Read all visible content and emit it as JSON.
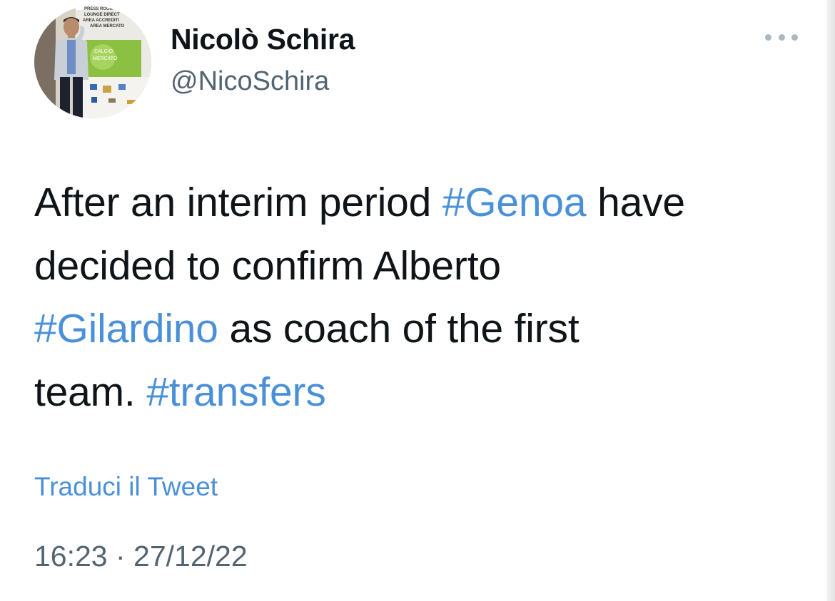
{
  "author": {
    "name": "Nicolò Schira",
    "handle": "@NicoSchira"
  },
  "avatar_sign_lines": [
    "PRESS ROOM",
    "LOUNGE DIRECT",
    "AREA ACCREDITI",
    "AREA MERCATO"
  ],
  "avatar_banner_text": [
    "CALCIO",
    "MERCATO"
  ],
  "tweet": {
    "lines": [
      [
        {
          "text": "After an interim period ",
          "hashtag": false
        },
        {
          "text": "#Genoa",
          "hashtag": true
        },
        {
          "text": " have",
          "hashtag": false
        }
      ],
      [
        {
          "text": "decided to confirm Alberto",
          "hashtag": false
        }
      ],
      [
        {
          "text": "#Gilardino",
          "hashtag": true
        },
        {
          "text": " as coach of the first",
          "hashtag": false
        }
      ],
      [
        {
          "text": "team. ",
          "hashtag": false
        },
        {
          "text": "#transfers",
          "hashtag": true
        }
      ]
    ]
  },
  "translate_label": "Traduci il Tweet",
  "timestamp": "16:23 · 27/12/22",
  "colors": {
    "text": "#0f1419",
    "secondary": "#536471",
    "link": "#4a90d9"
  },
  "icons": {
    "more": "more-horizontal-icon"
  }
}
